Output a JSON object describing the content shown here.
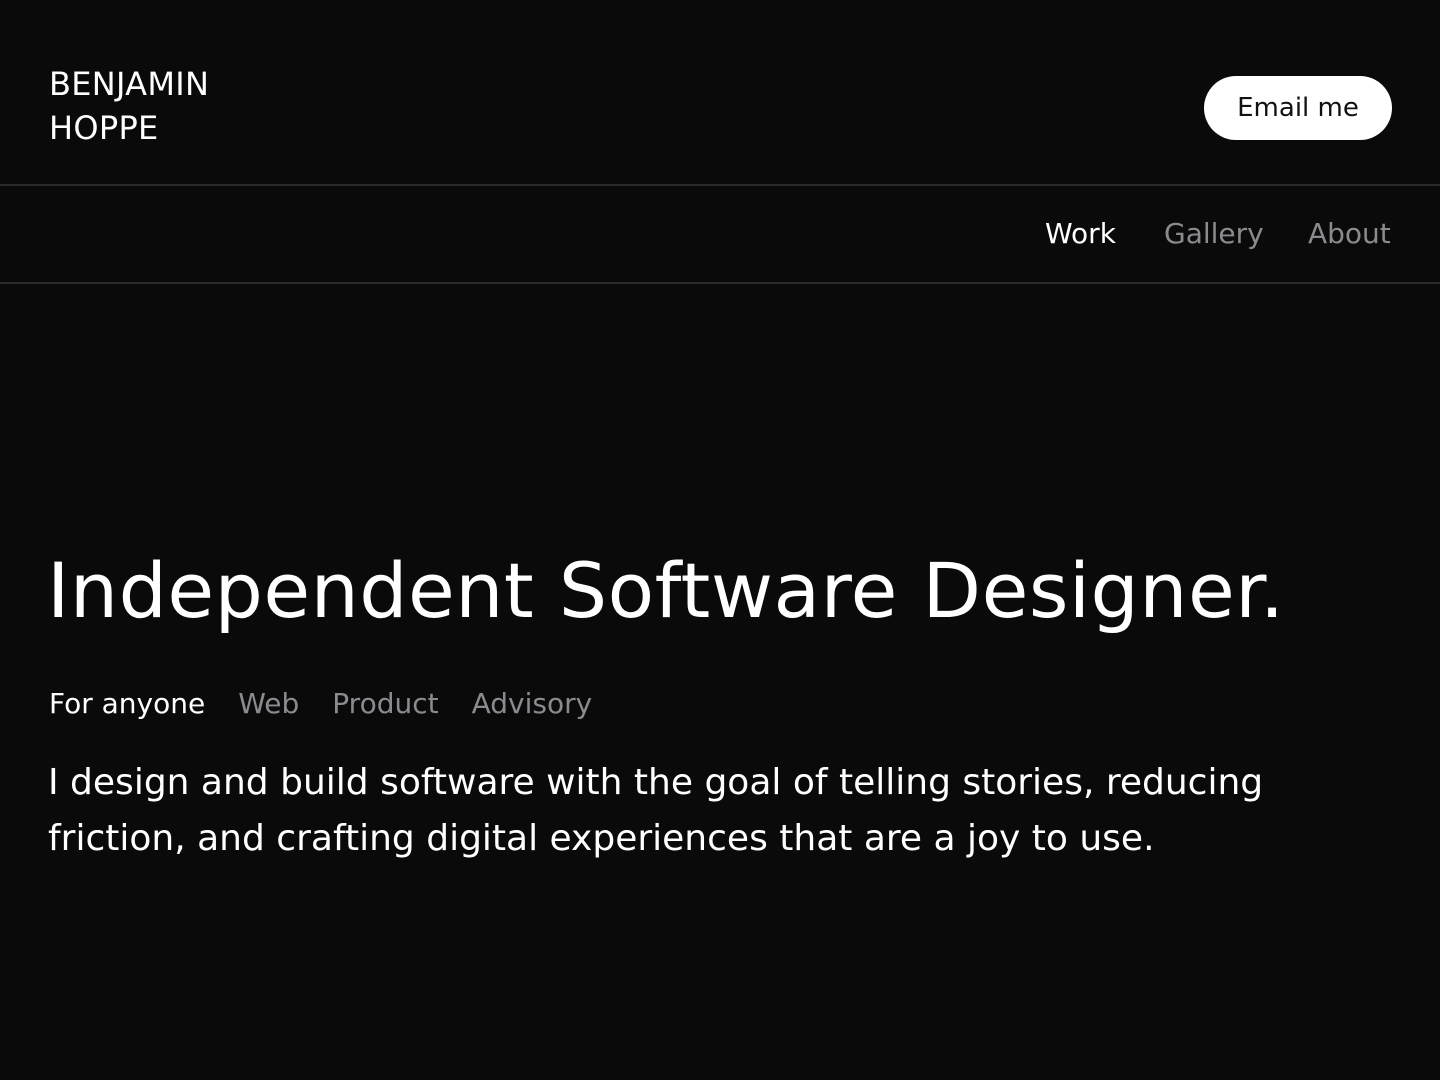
{
  "header": {
    "logo_line1": "BENJAMIN",
    "logo_line2": "HOPPE",
    "email_button": "Email me"
  },
  "nav": {
    "items": [
      {
        "label": "Work",
        "active": true
      },
      {
        "label": "Gallery",
        "active": false
      },
      {
        "label": "About",
        "active": false
      }
    ]
  },
  "hero": {
    "title": "Independent Software Designer.",
    "filters": [
      {
        "label": "For anyone",
        "active": true
      },
      {
        "label": "Web",
        "active": false
      },
      {
        "label": "Product",
        "active": false
      },
      {
        "label": "Advisory",
        "active": false
      }
    ],
    "description": "I design and build software with the goal of telling stories, reducing friction, and crafting digital experiences that are a joy to use."
  },
  "colors": {
    "background": "#0a0a0a",
    "text_primary": "#ffffff",
    "text_muted": "#8a8a8f",
    "divider": "#2a2a2a",
    "button_bg": "#ffffff",
    "button_text": "#111111"
  }
}
